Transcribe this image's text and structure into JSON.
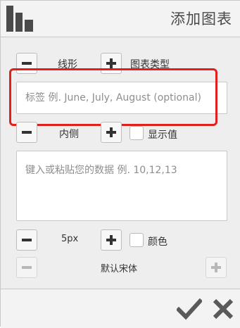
{
  "header": {
    "title": "添加图表",
    "logo_icon": "bar-chart-icon"
  },
  "controls": {
    "row1": {
      "minus_icon": "minus-icon",
      "type_label": "线形",
      "plus_icon": "plus-icon",
      "category_label": "图表类型"
    },
    "labels_input": {
      "placeholder": "标签 例. June, July, August (optional)"
    },
    "row2": {
      "minus_icon": "minus-icon",
      "position_label": "内侧",
      "plus_icon": "plus-icon",
      "show_values_label": "显示值"
    },
    "data_input": {
      "placeholder": "键入或粘贴您的数据 例. 10,12,13"
    },
    "row3": {
      "minus_icon": "minus-icon",
      "size_label": "5px",
      "plus_icon": "plus-icon",
      "color_label": "颜色"
    },
    "row4": {
      "minus_icon": "minus-icon",
      "font_label": "默认宋体",
      "plus_icon": "plus-icon"
    }
  },
  "footer": {
    "confirm_icon": "checkmark-icon",
    "close_icon": "close-icon"
  },
  "colors": {
    "highlight": "#e0201d",
    "icon": "#4a4a4a",
    "panel": "#eeeeee"
  }
}
